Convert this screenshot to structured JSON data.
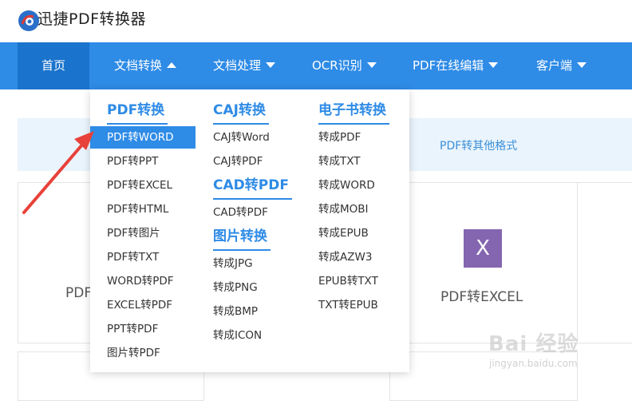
{
  "header": {
    "brand": "迅捷PDF转换器"
  },
  "nav": {
    "home": "首页",
    "items": [
      "文档转换",
      "文档处理",
      "OCR识别",
      "PDF在线编辑",
      "客户端"
    ]
  },
  "page": {
    "sub_tab": "PDF转其他格式",
    "cards": {
      "left_partial": "PDF",
      "excel_label": "PDF转EXCEL",
      "excel_icon": "X"
    }
  },
  "dropdown": {
    "columns": [
      {
        "sections": [
          {
            "heading": "PDF转换",
            "items": [
              "PDF转WORD",
              "PDF转PPT",
              "PDF转EXCEL",
              "PDF转HTML",
              "PDF转图片",
              "PDF转TXT",
              "WORD转PDF",
              "EXCEL转PDF",
              "PPT转PDF",
              "图片转PDF"
            ]
          }
        ]
      },
      {
        "sections": [
          {
            "heading": "CAJ转换",
            "items": [
              "CAJ转Word",
              "CAJ转PDF"
            ]
          },
          {
            "heading": "CAD转PDF",
            "items": [
              "CAD转PDF"
            ]
          },
          {
            "heading": "图片转换",
            "items": [
              "转成JPG",
              "转成PNG",
              "转成BMP",
              "转成ICON"
            ]
          }
        ]
      },
      {
        "sections": [
          {
            "heading": "电子书转换",
            "items": [
              "转成PDF",
              "转成TXT",
              "转成WORD",
              "转成MOBI",
              "转成EPUB",
              "转成AZW3",
              "EPUB转TXT",
              "TXT转EPUB"
            ]
          }
        ]
      }
    ],
    "active_item": "PDF转WORD"
  },
  "watermark": {
    "main": "Bai 经验",
    "sub": "jingyan.baidu.com"
  },
  "colors": {
    "nav": "#2e8be6",
    "nav_active": "#1a73cc",
    "accent": "#2e8be6",
    "arrow": "#e8413a",
    "excel": "#8466b0"
  }
}
